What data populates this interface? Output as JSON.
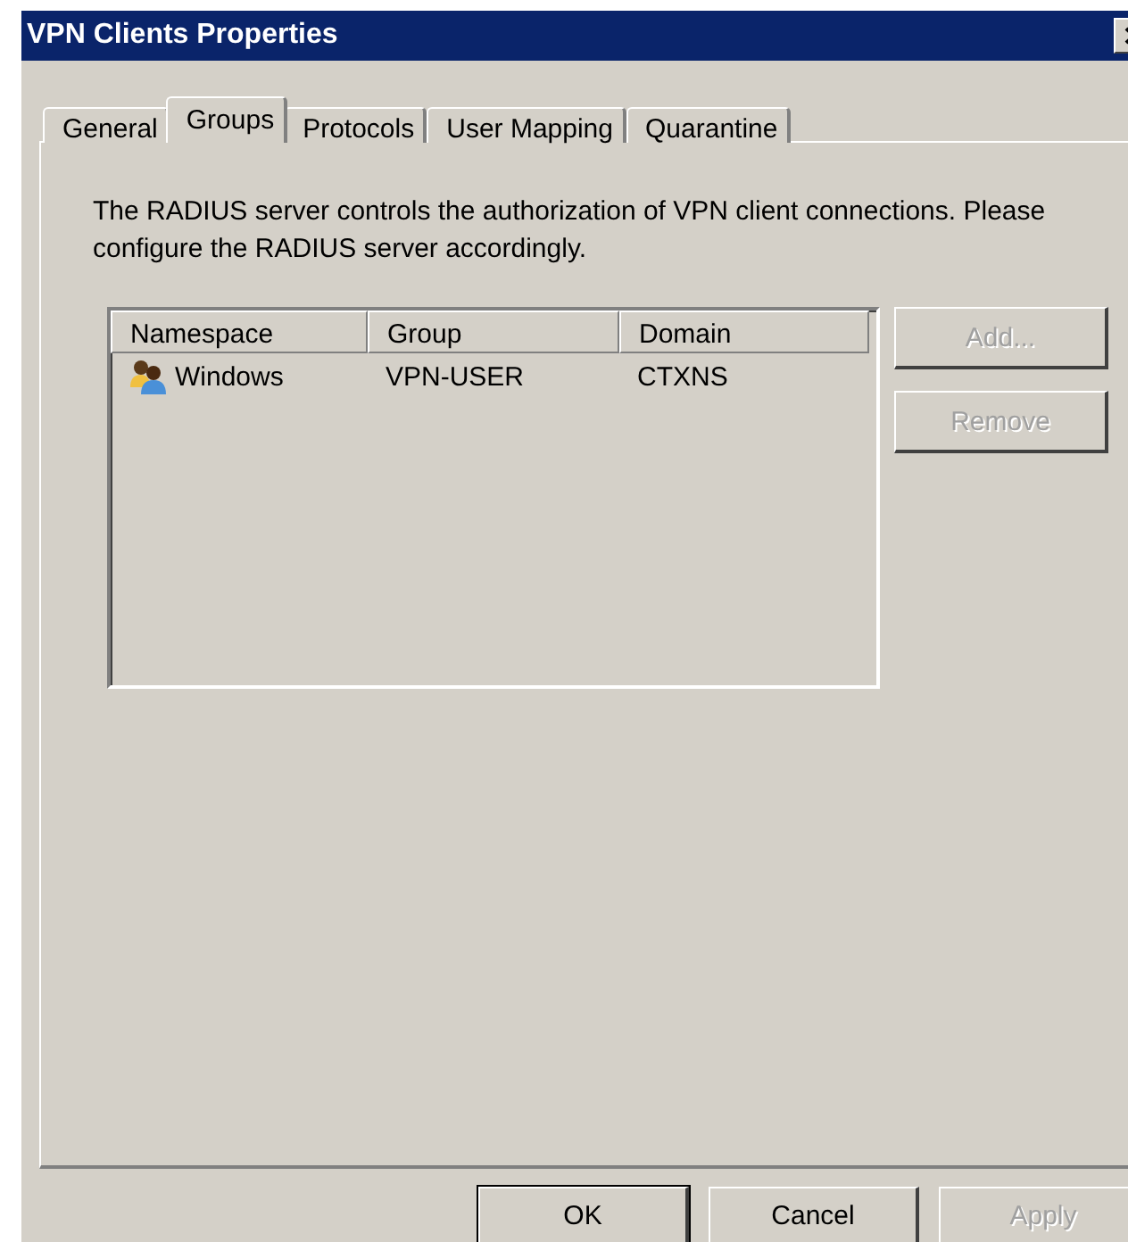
{
  "window": {
    "title": "VPN Clients Properties"
  },
  "tabs": [
    {
      "label": "General",
      "selected": false
    },
    {
      "label": "Groups",
      "selected": true
    },
    {
      "label": "Protocols",
      "selected": false
    },
    {
      "label": "User Mapping",
      "selected": false
    },
    {
      "label": "Quarantine",
      "selected": false
    }
  ],
  "description": "The RADIUS server controls the authorization of VPN client connections. Please configure the RADIUS server accordingly.",
  "list": {
    "columns": [
      "Namespace",
      "Group",
      "Domain"
    ],
    "rows": [
      {
        "cells": [
          "Windows",
          "VPN-USER",
          "CTXNS"
        ],
        "selected": false
      }
    ]
  },
  "side_buttons": [
    {
      "label": "Add...",
      "disabled": true
    },
    {
      "label": "Remove",
      "disabled": true
    }
  ],
  "dialog_buttons": [
    {
      "label": "OK",
      "disabled": false,
      "default": true
    },
    {
      "label": "Cancel",
      "disabled": false,
      "default": false
    },
    {
      "label": "Apply",
      "disabled": true,
      "default": false
    }
  ]
}
